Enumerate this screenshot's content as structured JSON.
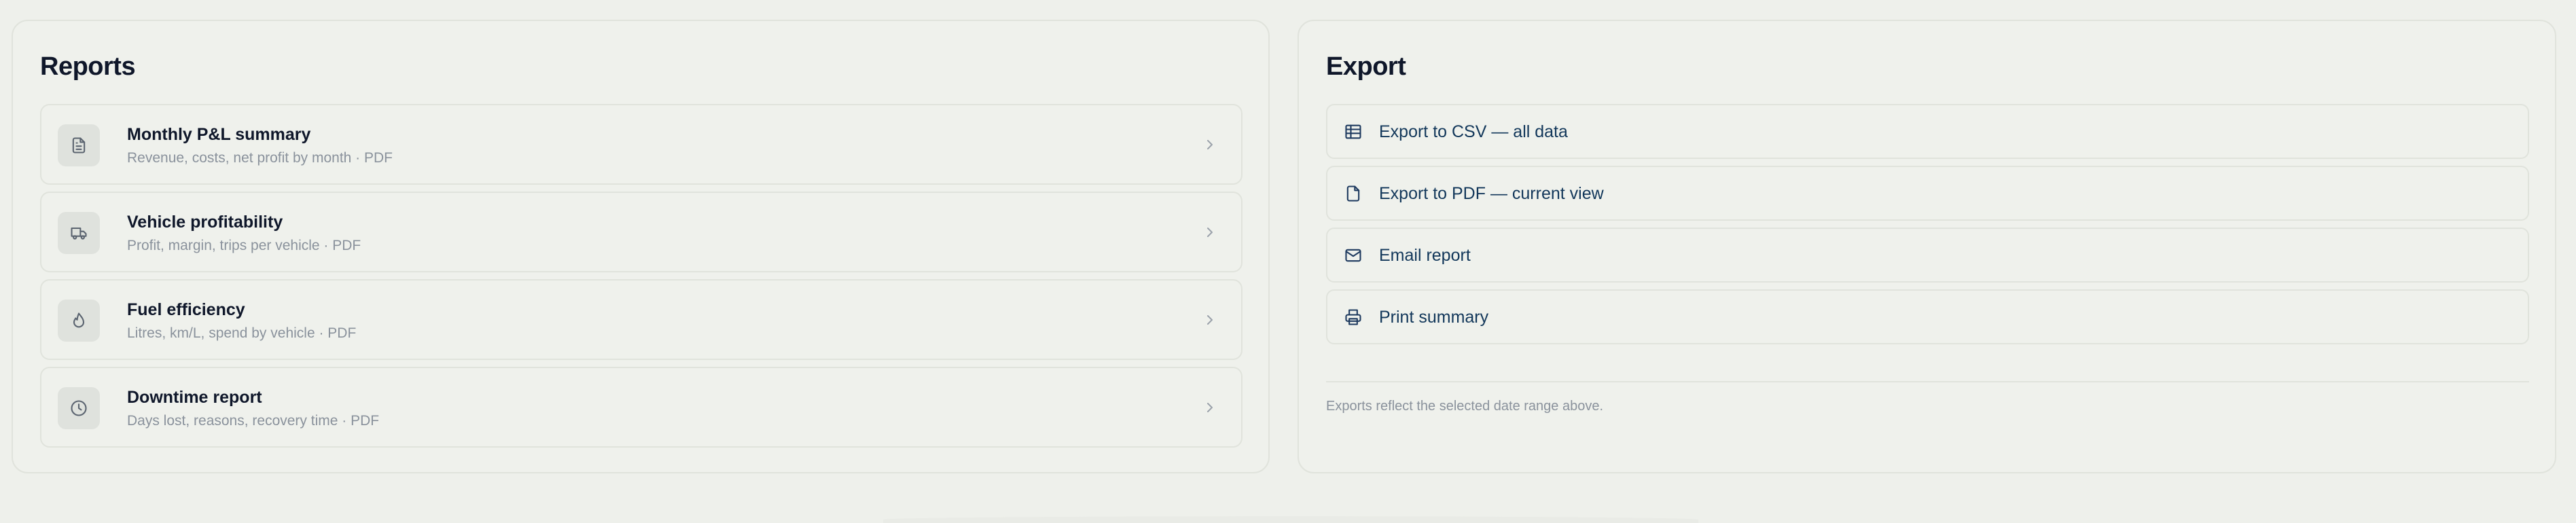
{
  "reports": {
    "title": "Reports",
    "items": [
      {
        "title": "Monthly P&L summary",
        "subtitle": "Revenue, costs, net profit by month · PDF",
        "icon": "document-icon"
      },
      {
        "title": "Vehicle profitability",
        "subtitle": "Profit, margin, trips per vehicle · PDF",
        "icon": "truck-icon"
      },
      {
        "title": "Fuel efficiency",
        "subtitle": "Litres, km/L, spend by vehicle · PDF",
        "icon": "fuel-drop-icon"
      },
      {
        "title": "Downtime report",
        "subtitle": "Days lost, reasons, recovery time · PDF",
        "icon": "clock-icon"
      }
    ]
  },
  "export": {
    "title": "Export",
    "items": [
      {
        "label": "Export to CSV — all data",
        "icon": "table-icon"
      },
      {
        "label": "Export to PDF — current view",
        "icon": "file-icon"
      },
      {
        "label": "Email report",
        "icon": "mail-icon"
      },
      {
        "label": "Print summary",
        "icon": "printer-icon"
      }
    ],
    "note": "Exports reflect the selected date range above."
  }
}
